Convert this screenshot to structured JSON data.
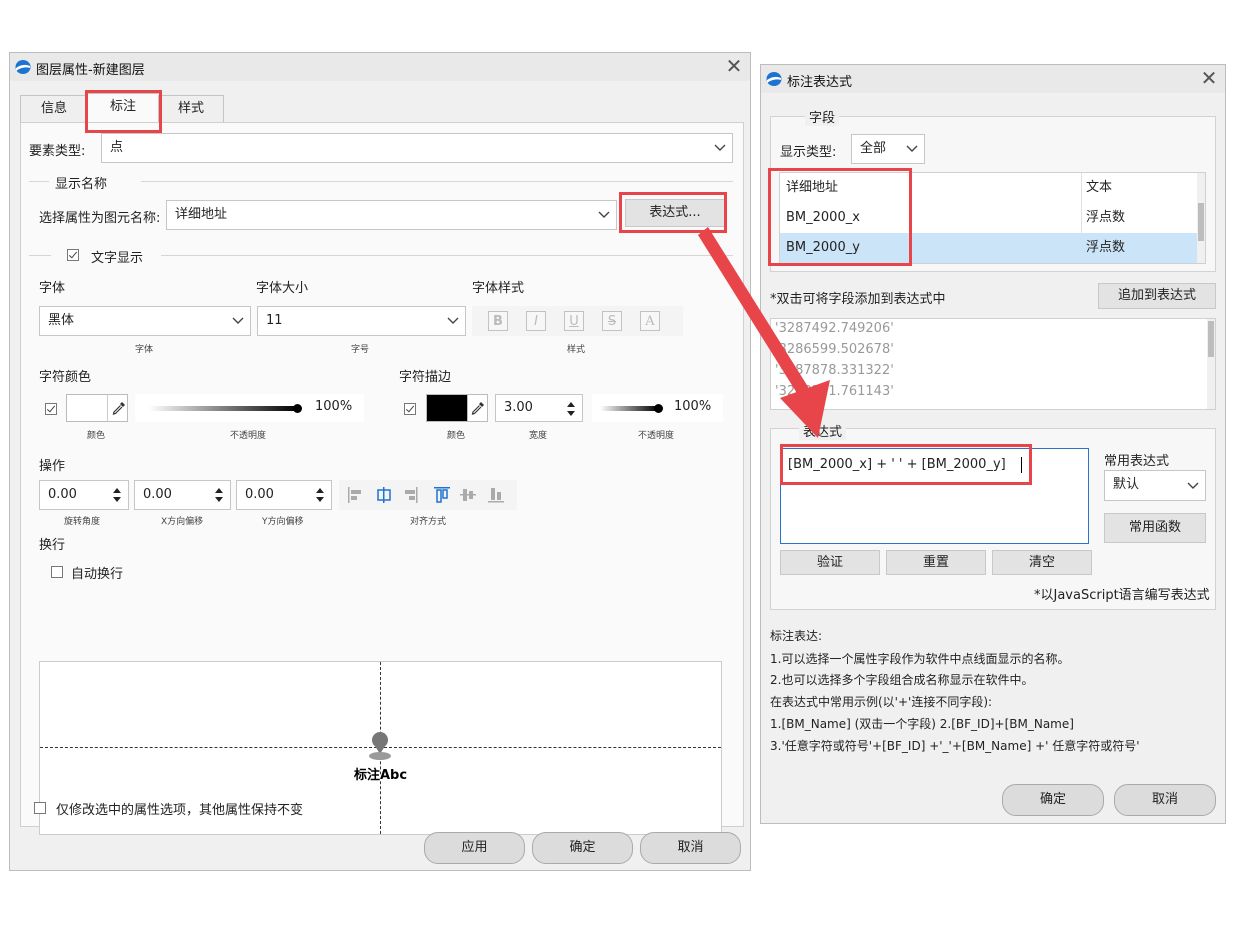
{
  "left_window": {
    "title": "图层属性-新建图层",
    "tabs": [
      "信息",
      "标注",
      "样式"
    ],
    "feature_type_label": "要素类型:",
    "feature_type_value": "点",
    "display_name_group": "显示名称",
    "select_attr_label": "选择属性为图元名称:",
    "select_attr_value": "详细地址",
    "expression_button": "表达式...",
    "text_display_label": "文字显示",
    "font_label": "字体",
    "font_value": "黑体",
    "font_caption": "字体",
    "font_size_label": "字体大小",
    "font_size_value": "11",
    "font_size_caption": "字号",
    "font_style_label": "字体样式",
    "font_style_caption": "样式",
    "font_style_icons": [
      "B",
      "I",
      "U",
      "S",
      "A"
    ],
    "char_color_label": "字符颜色",
    "char_color_caption": "颜色",
    "char_opacity_value": "100%",
    "char_opacity_caption": "不透明度",
    "char_outline_label": "字符描边",
    "outline_color_caption": "颜色",
    "outline_width_value": "3.00",
    "outline_width_caption": "宽度",
    "outline_opacity_value": "100%",
    "outline_opacity_caption": "不透明度",
    "operation_label": "操作",
    "rotation_value": "0.00",
    "rotation_caption": "旋转角度",
    "x_offset_value": "0.00",
    "x_offset_caption": "X方向偏移",
    "y_offset_value": "0.00",
    "y_offset_caption": "Y方向偏移",
    "align_caption": "对齐方式",
    "wrap_label": "换行",
    "auto_wrap_label": "自动换行",
    "preview_text": "标注Abc",
    "only_modify_label": "仅修改选中的属性选项，其他属性保持不变",
    "apply_button": "应用",
    "ok_button": "确定",
    "cancel_button": "取消"
  },
  "right_window": {
    "title": "标注表达式",
    "fields_group": "字段",
    "display_type_label": "显示类型:",
    "display_type_value": "全部",
    "fields": [
      {
        "name": "详细地址",
        "type": "文本"
      },
      {
        "name": "BM_2000_x",
        "type": "浮点数"
      },
      {
        "name": "BM_2000_y",
        "type": "浮点数"
      }
    ],
    "double_click_hint": "*双击可将字段添加到表达式中",
    "add_button": "追加到表达式",
    "values": [
      "'3287492.749206'",
      "'3286599.502678'",
      "'3287878.331322'",
      "'3288391.761143'"
    ],
    "expression_group": "表达式",
    "expression_text": "[BM_2000_x]  + ' ' + [BM_2000_y]",
    "common_expr_label": "常用表达式",
    "common_expr_value": "默认",
    "common_func_button": "常用函数",
    "verify_button": "验证",
    "reset_button": "重置",
    "clear_button": "清空",
    "js_note": "*以JavaScript语言编写表达式",
    "help_lines": [
      "标注表达:",
      "1.可以选择一个属性字段作为软件中点线面显示的名称。",
      "2.也可以选择多个字段组合成名称显示在软件中。",
      "在表达式中常用示例(以'+'连接不同字段):",
      "1.[BM_Name]   (双击一个字段)        2.[BF_ID]+[BM_Name]",
      "3.'任意字符或符号'+[BF_ID] +'_'+[BM_Name] +' 任意字符或符号'"
    ],
    "ok_button": "确定",
    "cancel_button": "取消"
  },
  "colors": {
    "highlight": "#e8454b",
    "selected_row": "#cce4f7",
    "accent_border": "#2a73c6"
  }
}
